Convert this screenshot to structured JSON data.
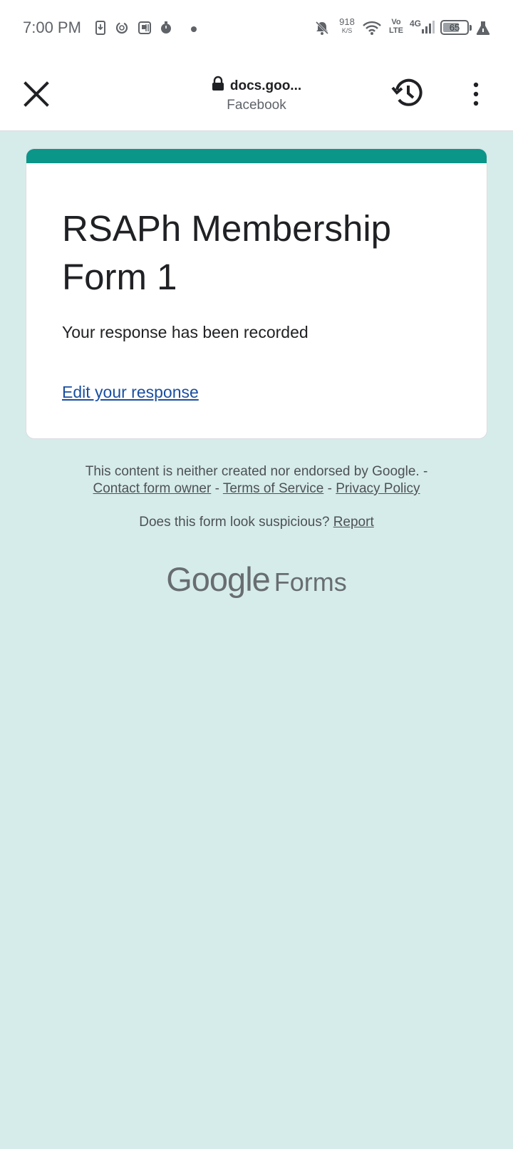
{
  "status_bar": {
    "time": "7:00 PM",
    "net_speed_value": "918",
    "net_speed_unit": "K/S",
    "volte_top": "Vo",
    "volte_bottom": "LTE",
    "network_type": "4G",
    "battery_level": "65",
    "icons": [
      "download-icon",
      "sync-icon",
      "screen-record-icon",
      "timer-icon",
      "dot-icon",
      "mute-bell-icon",
      "wifi-icon",
      "signal-icon",
      "battery-icon",
      "flask-icon"
    ]
  },
  "toolbar": {
    "url": "docs.goo...",
    "subtitle": "Facebook",
    "icons": [
      "close-icon",
      "lock-icon",
      "history-icon",
      "more-vert-icon"
    ]
  },
  "form": {
    "accent_color": "#0a9689",
    "title": "RSAPh Membership Form 1",
    "message": "Your response has been recorded",
    "edit_link": "Edit your response"
  },
  "footer": {
    "disclaimer": "This content is neither created nor endorsed by Google. -",
    "contact_link": "Contact form owner",
    "sep1": " - ",
    "terms_link": "Terms of Service",
    "sep2": " - ",
    "privacy_link": "Privacy Policy",
    "suspicious_text": "Does this form look suspicious? ",
    "report_link": "Report",
    "brand_google": "Google",
    "brand_forms": "Forms"
  },
  "colors": {
    "page_background": "#d6ecea",
    "link": "#1a4fa0"
  }
}
